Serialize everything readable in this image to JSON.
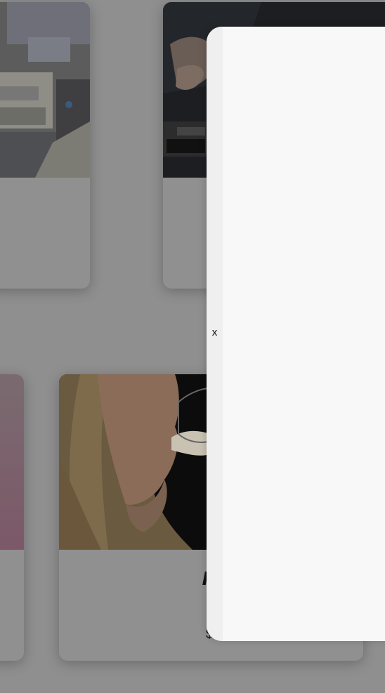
{
  "cards": [
    {
      "title": "",
      "price": ""
    },
    {
      "title": "",
      "price": ""
    },
    {
      "title": "",
      "price": ""
    },
    {
      "title": "M",
      "price": "$."
    }
  ],
  "drawer": {
    "close_label": "x"
  },
  "colors": {
    "backdrop": "#8f8f8f",
    "drawer_bg": "#f8f8f8",
    "drawer_rail": "#efefef"
  }
}
